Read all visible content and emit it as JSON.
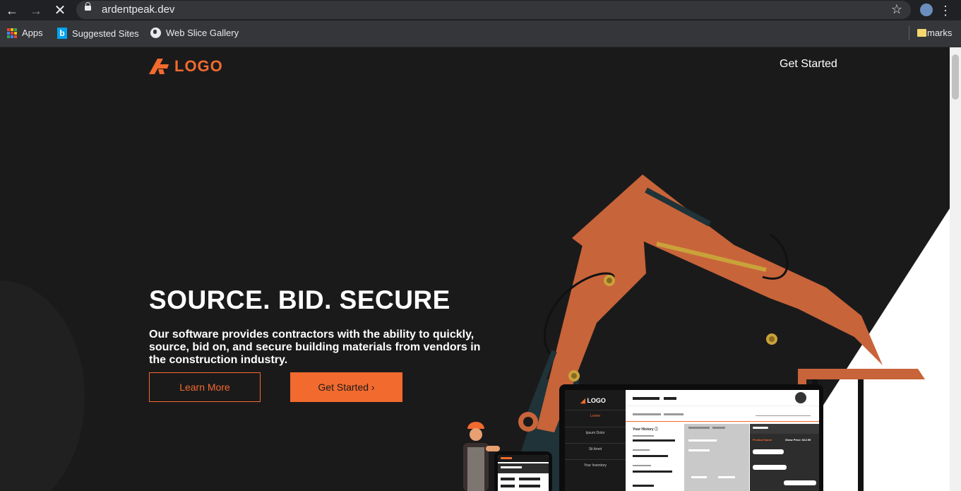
{
  "browser": {
    "url": "ardentpeak.dev",
    "bookmarks": [
      {
        "label": "Apps",
        "icon": "apps-grid-icon"
      },
      {
        "label": "Suggested Sites",
        "icon": "bing-icon"
      },
      {
        "label": "Web Slice Gallery",
        "icon": "globe-icon"
      }
    ],
    "other_bookmarks": "marks"
  },
  "site": {
    "logo_text": "LOGO",
    "nav_get_started": "Get Started",
    "headline": "SOURCE. BID. SECURE",
    "description": "Our software provides contractors with the ability to quickly, source, bid on, and secure building materials from vendors in the construction industry.",
    "learn_more": "Learn More",
    "get_started_button": "Get Started  ›",
    "accent_color": "#f26a2e",
    "background_color": "#1b1a1b"
  },
  "mockup": {
    "logo_text": "LOGO",
    "nav_items": [
      "Lorem",
      "Ipsum Dolor",
      "Sit Amet",
      "Your Inventory"
    ],
    "history_label": "Your History ⓘ",
    "product_label": "Product Name",
    "price_label": "Show Price: $12.99"
  }
}
